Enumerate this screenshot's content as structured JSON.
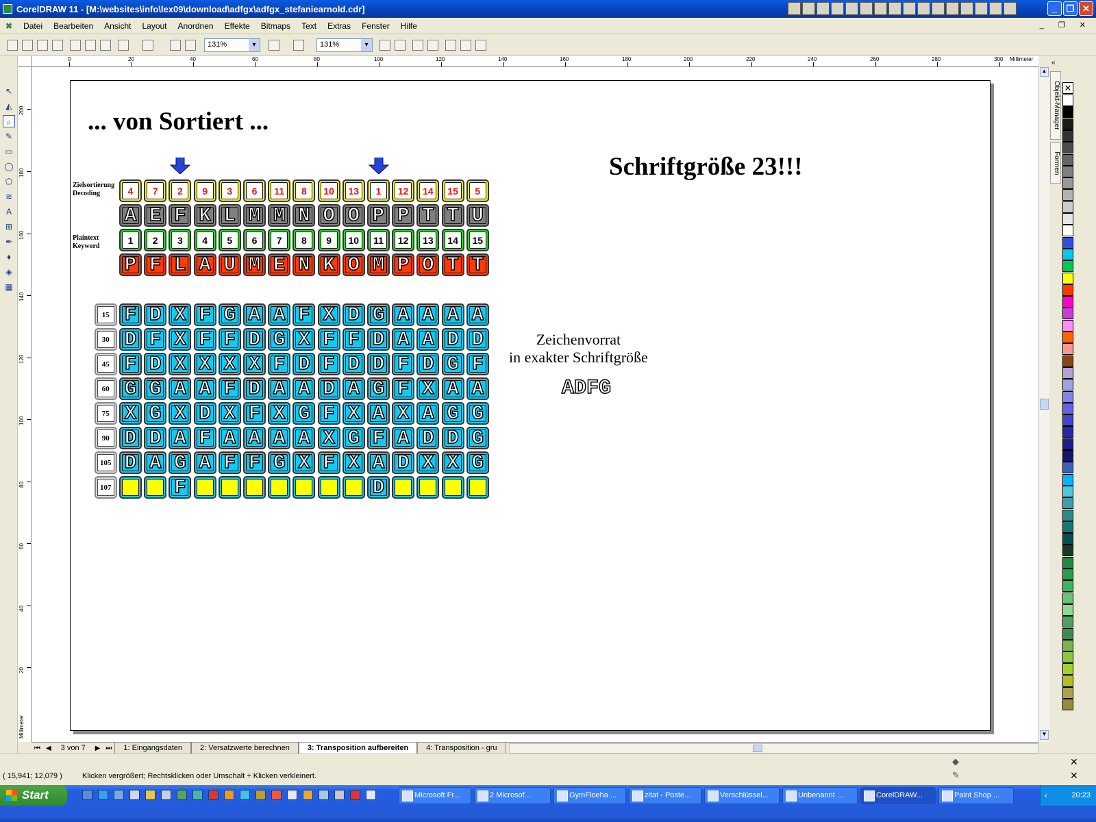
{
  "window": {
    "title": "CorelDRAW 11 - [M:\\websites\\info\\lex09\\download\\adfgx\\adfgx_stefaniearnold.cdr]"
  },
  "menu": [
    "Datei",
    "Bearbeiten",
    "Ansicht",
    "Layout",
    "Anordnen",
    "Effekte",
    "Bitmaps",
    "Text",
    "Extras",
    "Fenster",
    "Hilfe"
  ],
  "toolbar": {
    "zoom1": "131%",
    "zoom2": "131%"
  },
  "ruler": {
    "h_labels": [
      "0",
      "20",
      "40",
      "60",
      "80",
      "100",
      "120",
      "140",
      "160",
      "180",
      "200",
      "220",
      "240",
      "260",
      "280",
      "300"
    ],
    "unit": "Millimeter",
    "v_labels": [
      "200",
      "180",
      "160",
      "140",
      "120",
      "100",
      "80",
      "60",
      "40",
      "20"
    ]
  },
  "side_tabs": [
    "Objekt-Manager",
    "Formen"
  ],
  "palette": [
    "#ffffff",
    "#000000",
    "#1a1a1a",
    "#333333",
    "#4d4d4d",
    "#666666",
    "#808080",
    "#999999",
    "#b3b3b3",
    "#cccccc",
    "#e6e6e6",
    "#ffffff",
    "#2b4fe6",
    "#00c8f0",
    "#00c850",
    "#ffff00",
    "#ff3800",
    "#ff00c8",
    "#c83cdc",
    "#ff8cff",
    "#ff6400",
    "#ff9696",
    "#8c4614",
    "#b4a0d2",
    "#a0a0e6",
    "#8282f0",
    "#6464e6",
    "#4646c8",
    "#2828aa",
    "#1e1e8c",
    "#14146e",
    "#3c64b4",
    "#00b4ff",
    "#50c8dc",
    "#3ca0aa",
    "#288c8c",
    "#147878",
    "#0a5050",
    "#143c28",
    "#1e8c3c",
    "#28a050",
    "#3cb464",
    "#64c878",
    "#8cdc96",
    "#50a064",
    "#3c8c50",
    "#78b450",
    "#8cc83c",
    "#a0d228",
    "#b4be28",
    "#aaa050",
    "#968c3c"
  ],
  "heading": "... von Sortiert ...",
  "font_note": "Schriftgröße 23!!!",
  "grid_labels": {
    "decoding": [
      "Zielsortierung",
      "Decoding"
    ],
    "keyword": [
      "Plaintext",
      "Keyword"
    ]
  },
  "decoding_nums": [
    "4",
    "7",
    "2",
    "9",
    "3",
    "6",
    "11",
    "8",
    "10",
    "13",
    "1",
    "12",
    "14",
    "15",
    "5"
  ],
  "sorted_letters": [
    "A",
    "E",
    "F",
    "K",
    "L",
    "M",
    "M",
    "N",
    "O",
    "O",
    "P",
    "P",
    "T",
    "T",
    "U"
  ],
  "plain_nums": [
    "1",
    "2",
    "3",
    "4",
    "5",
    "6",
    "7",
    "8",
    "9",
    "10",
    "11",
    "12",
    "13",
    "14",
    "15"
  ],
  "keyword_letters": [
    "P",
    "F",
    "L",
    "A",
    "U",
    "M",
    "E",
    "N",
    "K",
    "O",
    "M",
    "P",
    "O",
    "T",
    "T"
  ],
  "grid": [
    {
      "label": "15",
      "cells": [
        "F",
        "D",
        "X",
        "F",
        "G",
        "A",
        "A",
        "F",
        "X",
        "D",
        "G",
        "A",
        "A",
        "A",
        "A"
      ]
    },
    {
      "label": "30",
      "cells": [
        "D",
        "F",
        "X",
        "F",
        "F",
        "D",
        "G",
        "X",
        "F",
        "F",
        "D",
        "A",
        "A",
        "D",
        "D"
      ]
    },
    {
      "label": "45",
      "cells": [
        "F",
        "D",
        "X",
        "X",
        "X",
        "X",
        "F",
        "D",
        "F",
        "D",
        "D",
        "F",
        "D",
        "G",
        "F"
      ]
    },
    {
      "label": "60",
      "cells": [
        "G",
        "G",
        "A",
        "A",
        "F",
        "D",
        "A",
        "A",
        "D",
        "A",
        "G",
        "F",
        "X",
        "A",
        "A"
      ]
    },
    {
      "label": "75",
      "cells": [
        "X",
        "G",
        "X",
        "D",
        "X",
        "F",
        "X",
        "G",
        "F",
        "X",
        "A",
        "X",
        "A",
        "G",
        "G"
      ]
    },
    {
      "label": "90",
      "cells": [
        "D",
        "D",
        "A",
        "F",
        "A",
        "A",
        "A",
        "A",
        "X",
        "G",
        "F",
        "A",
        "D",
        "D",
        "G"
      ]
    },
    {
      "label": "105",
      "cells": [
        "D",
        "A",
        "G",
        "A",
        "F",
        "F",
        "G",
        "X",
        "F",
        "X",
        "A",
        "D",
        "X",
        "X",
        "G"
      ]
    },
    {
      "label": "107",
      "cells": [
        "",
        "",
        "F",
        "",
        "",
        "",
        "",
        "",
        "",
        "",
        "D",
        "",
        "",
        "",
        ""
      ]
    }
  ],
  "charset_text": [
    "Zeichenvorrat",
    "in exakter Schriftgröße"
  ],
  "charset_letters": "ADFG",
  "pages": {
    "counter": "3 von 7",
    "tabs": [
      "1: Eingangsdaten",
      "2: Versatzwerte berechnen",
      "3: Transposition aufbereiten",
      "4: Transposition - gru"
    ],
    "active": 2
  },
  "status": {
    "coords": "( 15,941; 12,079 )",
    "hint": "Klicken vergrößert; Rechtsklicken oder Umschalt + Klicken verkleinert."
  },
  "taskbar": {
    "start": "Start",
    "tasks": [
      "Microsoft Fr...",
      "2 Microsof...",
      "GymFloeha ...",
      "zitat - Poste...",
      "Verschlüssel...",
      "Unbenannt ...",
      "CorelDRAW...",
      "Paint Shop ..."
    ],
    "active_task": 6,
    "clock": "20:23"
  },
  "colors": {
    "yellow": "#ffff00",
    "gray": "#808080",
    "green": "#22dd22",
    "red": "#ff3a0a",
    "cyan": "#14c8f0",
    "arrow": "#2244dd"
  }
}
